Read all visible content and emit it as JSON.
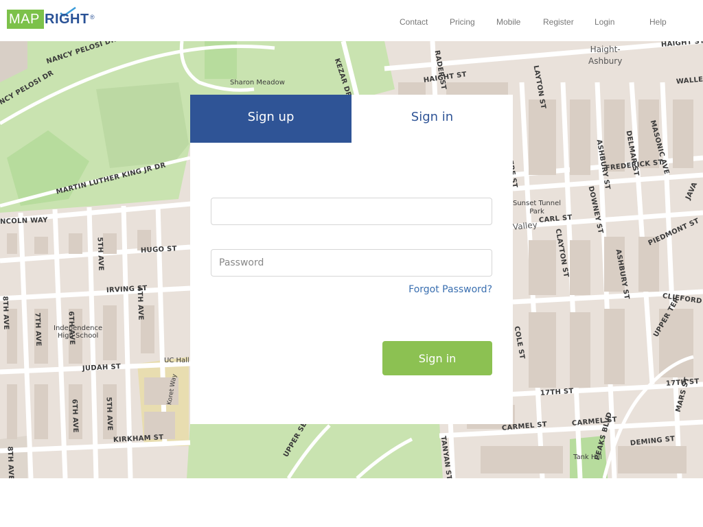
{
  "brand": {
    "logo_part1": "MAP",
    "logo_part2": "RIGHT",
    "registered": "®",
    "green": "#7cc14a",
    "blue": "#2a5296"
  },
  "nav": {
    "contact": "Contact",
    "pricing": "Pricing",
    "mobile": "Mobile",
    "register": "Register",
    "login": "Login",
    "help": "Help"
  },
  "tabs": {
    "signup": "Sign up",
    "signin": "Sign in"
  },
  "form": {
    "email_value": "",
    "email_placeholder": "",
    "password_placeholder": "Password",
    "forgot_password": "Forgot Password?",
    "submit": "Sign in"
  },
  "map": {
    "labels": {
      "haight_ashbury": "Haight-\nAshbury",
      "sharon_meadow": "Sharon Meadow",
      "nancy_pelosi_1": "NANCY PELOSI DR",
      "nancy_pelosi_2": "NCY PELOSI DR",
      "kezar": "KEZAR DR",
      "haight_st_1": "HAIGHT ST",
      "haight_st_2": "HAIGHT ST",
      "waller": "WALLE",
      "frederick": "FREDERICK ST",
      "mlk": "MARTIN LUTHER KING JR DR",
      "lincoln": "NCOLN WAY",
      "hugo": "HUGO ST",
      "irving": "IRVING ST",
      "judah": "JUDAH ST",
      "kirkham": "KIRKHAM ST",
      "carl": "CARL ST",
      "clifford": "CLIFFORD",
      "piedmont": "PIEDMONT ST",
      "st17_1": "17TH ST",
      "st17_2": "17TH ST",
      "carmel_1": "CARMEL ST",
      "carmel_2": "CARMEL ST",
      "deming": "DEMING ST",
      "tank_hill": "Tank Hill",
      "sunset_tunnel": "Sunset Tunnel\nPark",
      "valley": "Valley",
      "independence": "Independence\nHigh School",
      "uc_hall": "UC Hall",
      "koret": "Koret Way",
      "ave5": "5TH AVE",
      "ave5b": "5TH AVE",
      "ave4": "4TH AVE",
      "ave6": "6TH AVE",
      "ave6b": "6TH AVE",
      "ave7": "7TH AVE",
      "ave8": "8TH AVE",
      "ave8b": "8TH AVE",
      "belvedere": "BELVEDERE ST",
      "ashbury_1": "ASHBURY ST",
      "ashbury_2": "ASHBURY ST",
      "delmar": "DELMAR ST",
      "masonic": "MASONIC AVE",
      "downey": "DOWNEY ST",
      "clayton_1": "CLAYTON ST",
      "clayton_2": "CLAYTON ST",
      "cole": "COLE ST",
      "upper_ter": "UPPER TER",
      "upper_service": "UPPER SERVICE R",
      "peaks": "PEAKS BLVD",
      "java": "JAVA",
      "rader": "RADER ST",
      "stanyan": "TANYAN ST",
      "marsst": "MARS ST",
      "clayton_top": "LAYTON ST"
    }
  }
}
